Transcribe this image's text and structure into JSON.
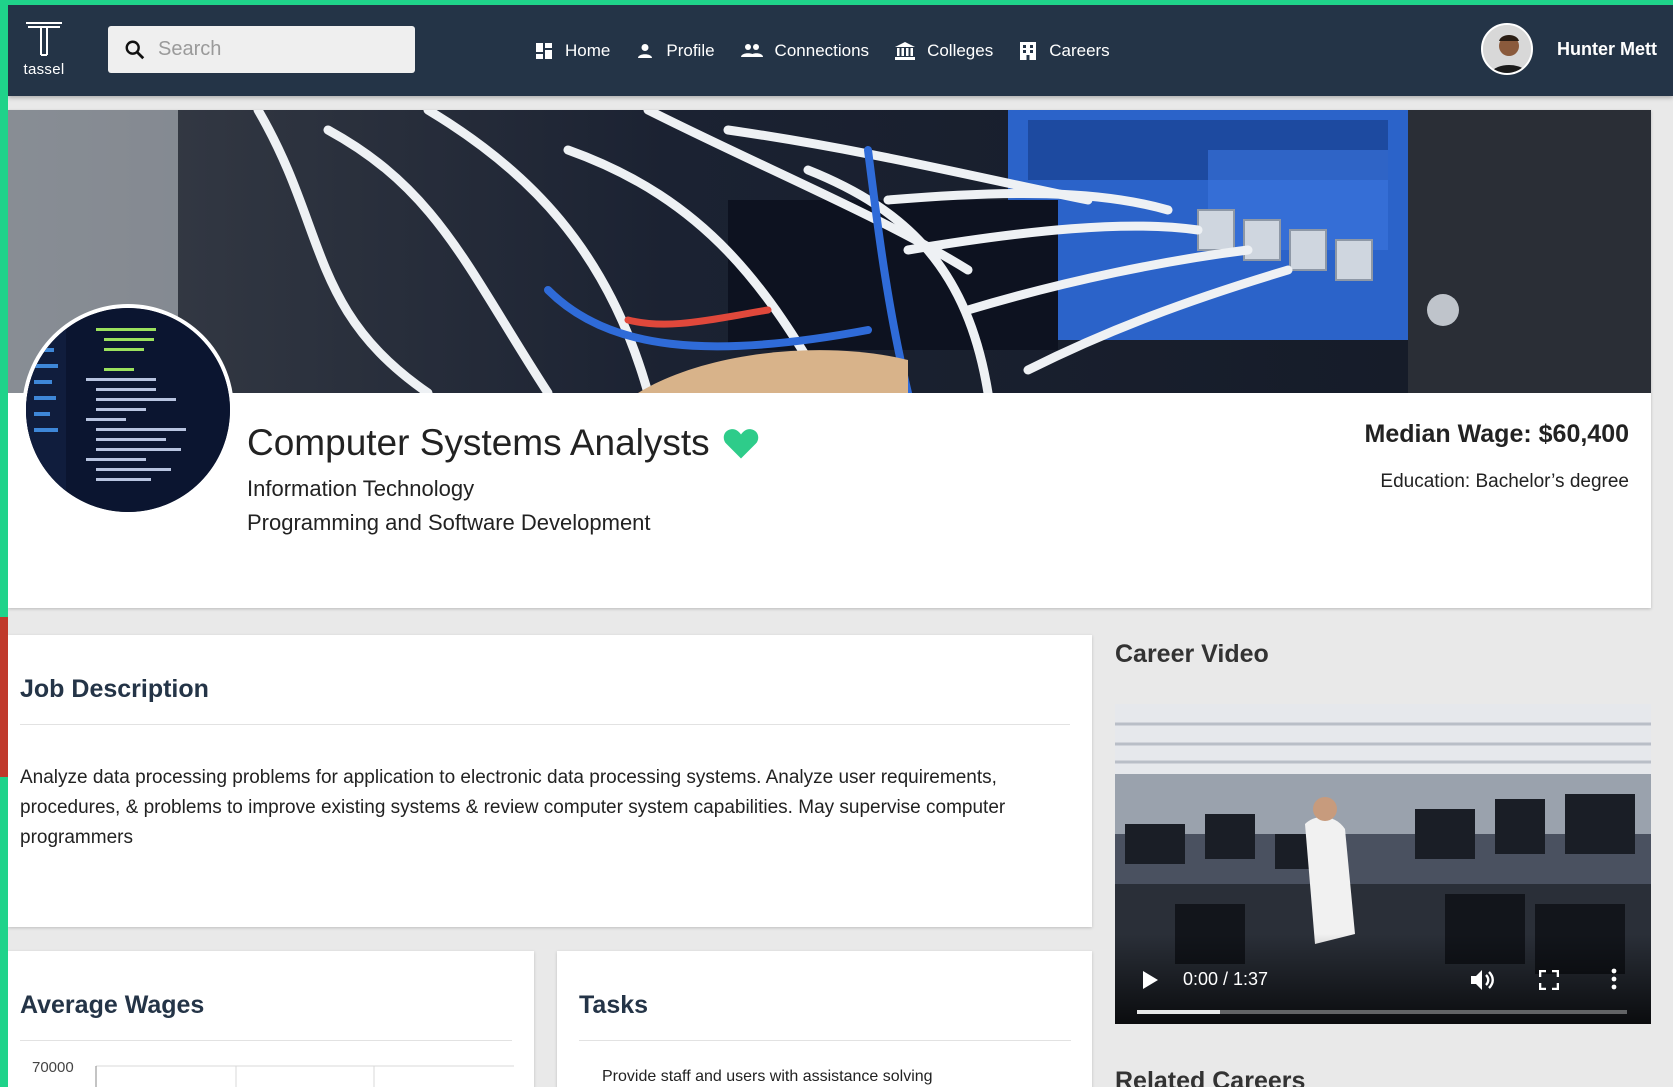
{
  "app": {
    "logo_text": "tassel"
  },
  "search": {
    "placeholder": "Search"
  },
  "nav": {
    "items": [
      {
        "label": "Home",
        "icon": "dashboard-icon"
      },
      {
        "label": "Profile",
        "icon": "person-icon"
      },
      {
        "label": "Connections",
        "icon": "people-icon"
      },
      {
        "label": "Colleges",
        "icon": "institution-icon"
      },
      {
        "label": "Careers",
        "icon": "building-icon"
      }
    ]
  },
  "user": {
    "name": "Hunter Mett"
  },
  "career": {
    "title": "Computer Systems Analysts",
    "favorited": true,
    "cluster": "Information Technology",
    "pathway": "Programming and Software Development",
    "median_wage": "Median Wage: $60,400",
    "education": "Education: Bachelor’s degree"
  },
  "job_description": {
    "heading": "Job Description",
    "text": "Analyze data processing problems for application to electronic data processing systems. Analyze user requirements, procedures, & problems to improve existing systems & review computer system capabilities. May supervise computer programmers"
  },
  "average_wages": {
    "heading": "Average Wages"
  },
  "chart_data": {
    "type": "bar",
    "title": "",
    "xlabel": "",
    "ylabel": "",
    "y_ticks": [
      "70000"
    ],
    "grid": true
  },
  "tasks": {
    "heading": "Tasks",
    "first_item": "Provide staff and users with assistance solving"
  },
  "career_video": {
    "heading": "Career Video",
    "time": "0:00 / 1:37",
    "buffered_fraction": 0.17
  },
  "related_careers": {
    "heading": "Related Careers"
  },
  "colors": {
    "navbar": "#243447",
    "accent": "#1fd38a",
    "heart": "#2ecc8a"
  }
}
